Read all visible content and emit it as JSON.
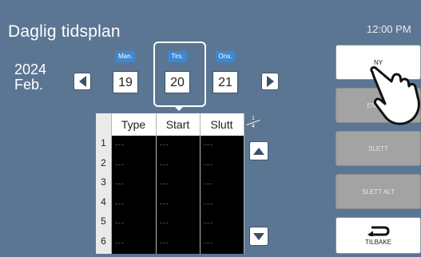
{
  "header": {
    "title": "Daglig tidsplan",
    "clock": "12:00 PM"
  },
  "date": {
    "year": "2024",
    "month": "Feb."
  },
  "days": [
    {
      "weekday": "Man.",
      "day": "19"
    },
    {
      "weekday": "Tirs.",
      "day": "20",
      "selected": true
    },
    {
      "weekday": "Ons.",
      "day": "21"
    }
  ],
  "table": {
    "columns": [
      "Type",
      "Start",
      "Slutt"
    ],
    "rows": [
      {
        "num": "1",
        "type": "---",
        "start": "---",
        "end": "---"
      },
      {
        "num": "2",
        "type": "---",
        "start": "---",
        "end": "---"
      },
      {
        "num": "3",
        "type": "---",
        "start": "---",
        "end": "---"
      },
      {
        "num": "4",
        "type": "---",
        "start": "---",
        "end": "---"
      },
      {
        "num": "5",
        "type": "---",
        "start": "---",
        "end": "---"
      },
      {
        "num": "6",
        "type": "---",
        "start": "---",
        "end": "---"
      }
    ]
  },
  "pagination": {
    "current": "1",
    "total": "4"
  },
  "sidebar": {
    "new": "NY",
    "edit": "ENDRE",
    "delete": "SLETT",
    "delete_all": "SLETT ALT",
    "back": "TILBAKE"
  },
  "icons": {
    "prev_day": "left-triangle-icon",
    "next_day": "right-triangle-icon",
    "scroll_up": "up-triangle-icon",
    "scroll_down": "down-triangle-icon",
    "back": "return-arrow-icon",
    "pointer": "hand-pointer-icon"
  },
  "colors": {
    "background": "#5b7693",
    "weekday_badge": "#3e88d0",
    "disabled_button": "#a3a3a3"
  }
}
